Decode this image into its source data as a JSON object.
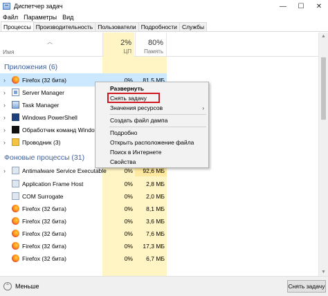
{
  "window": {
    "title": "Диспетчер задач",
    "minimize": "—",
    "maximize": "☐",
    "close": "✕"
  },
  "menu": [
    "Файл",
    "Параметры",
    "Вид"
  ],
  "tabs": [
    "Процессы",
    "Производительность",
    "Пользователи",
    "Подробности",
    "Службы"
  ],
  "columns": {
    "name": "Имя",
    "cpu_pct": "2%",
    "cpu_label": "ЦП",
    "mem_pct": "80%",
    "mem_label": "Память"
  },
  "groups": {
    "apps": "Приложения (6)",
    "background": "Фоновые процессы (31)"
  },
  "apps": [
    {
      "name": "Firefox (32 бита)",
      "icon": "firefox-icon",
      "cpu": "0%",
      "mem": "81,5 МБ"
    },
    {
      "name": "Server Manager",
      "icon": "server-manager-icon",
      "cpu": "",
      "mem": ""
    },
    {
      "name": "Task Manager",
      "icon": "task-manager-icon",
      "cpu": "",
      "mem": ""
    },
    {
      "name": "Windows PowerShell",
      "icon": "powershell-icon",
      "cpu": "",
      "mem": ""
    },
    {
      "name": "Обработчик команд Windows",
      "icon": "cmd-icon",
      "cpu": "",
      "mem": ""
    },
    {
      "name": "Проводник (3)",
      "icon": "explorer-icon",
      "cpu": "",
      "mem": ""
    }
  ],
  "background": [
    {
      "name": "Antimalware Service Executable",
      "icon": "frame-host-icon",
      "cpu": "0%",
      "mem": "92,6 МБ"
    },
    {
      "name": "Application Frame Host",
      "icon": "frame-host-icon",
      "cpu": "0%",
      "mem": "2,8 МБ"
    },
    {
      "name": "COM Surrogate",
      "icon": "frame-host-icon",
      "cpu": "0%",
      "mem": "2,0 МБ"
    },
    {
      "name": "Firefox (32 бита)",
      "icon": "firefox-icon",
      "cpu": "0%",
      "mem": "8,1 МБ"
    },
    {
      "name": "Firefox (32 бита)",
      "icon": "firefox-icon",
      "cpu": "0%",
      "mem": "3,6 МБ"
    },
    {
      "name": "Firefox (32 бита)",
      "icon": "firefox-icon",
      "cpu": "0%",
      "mem": "7,6 МБ"
    },
    {
      "name": "Firefox (32 бита)",
      "icon": "firefox-icon",
      "cpu": "0%",
      "mem": "17,3 МБ"
    },
    {
      "name": "Firefox (32 бита)",
      "icon": "firefox-icon",
      "cpu": "0%",
      "mem": "6,7 МБ"
    }
  ],
  "context_menu": {
    "expand": "Развернуть",
    "end_task": "Снять задачу",
    "resource_values": "Значения ресурсов",
    "submenu_arrow": "›",
    "create_dump": "Создать файл дампа",
    "details": "Подробно",
    "open_location": "Открыть расположение файла",
    "search_online": "Поиск в Интернете",
    "properties": "Свойства"
  },
  "footer": {
    "less": "Меньше",
    "end_task": "Снять задачу"
  },
  "colors": {
    "group_text": "#3c5f9b",
    "cpu_band": "#fff4c4",
    "selection": "#cce8ff",
    "highlight_box": "#d0161f"
  }
}
